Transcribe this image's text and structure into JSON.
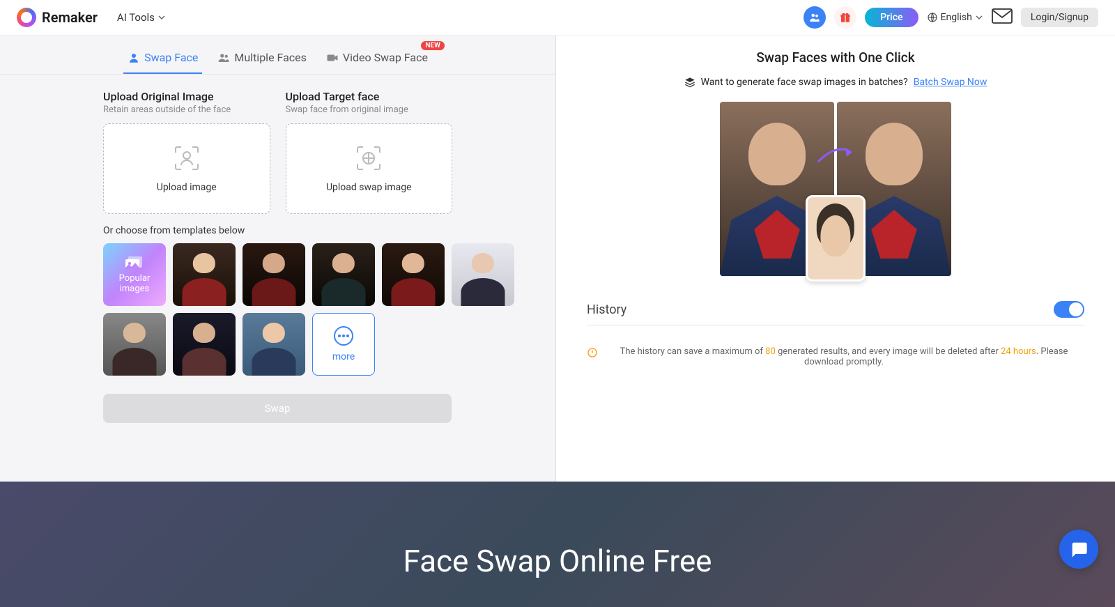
{
  "header": {
    "brand": "Remaker",
    "ai_tools": "AI Tools",
    "price": "Price",
    "language": "English",
    "login": "Login/Signup"
  },
  "tabs": {
    "swap_face": "Swap Face",
    "multiple_faces": "Multiple Faces",
    "video_swap": "Video Swap Face",
    "new_badge": "NEW"
  },
  "upload": {
    "original_title": "Upload Original Image",
    "original_sub": "Retain areas outside of the face",
    "original_btn": "Upload image",
    "target_title": "Upload Target face",
    "target_sub": "Swap face from original image",
    "target_btn": "Upload swap image"
  },
  "templates": {
    "label": "Or choose from templates below",
    "popular": "Popular images",
    "more": "more"
  },
  "swap_button": "Swap",
  "right": {
    "title": "Swap Faces with One Click",
    "batch_question": "Want to generate face swap images in batches?",
    "batch_link": "Batch Swap Now",
    "history": "History",
    "note_pre": "The history can save a maximum of ",
    "note_80": "80",
    "note_mid": " generated results, and every image will be deleted after ",
    "note_24": "24 hours",
    "note_end": ". Please download promptly."
  },
  "hero": {
    "title": "Face Swap Online Free"
  }
}
